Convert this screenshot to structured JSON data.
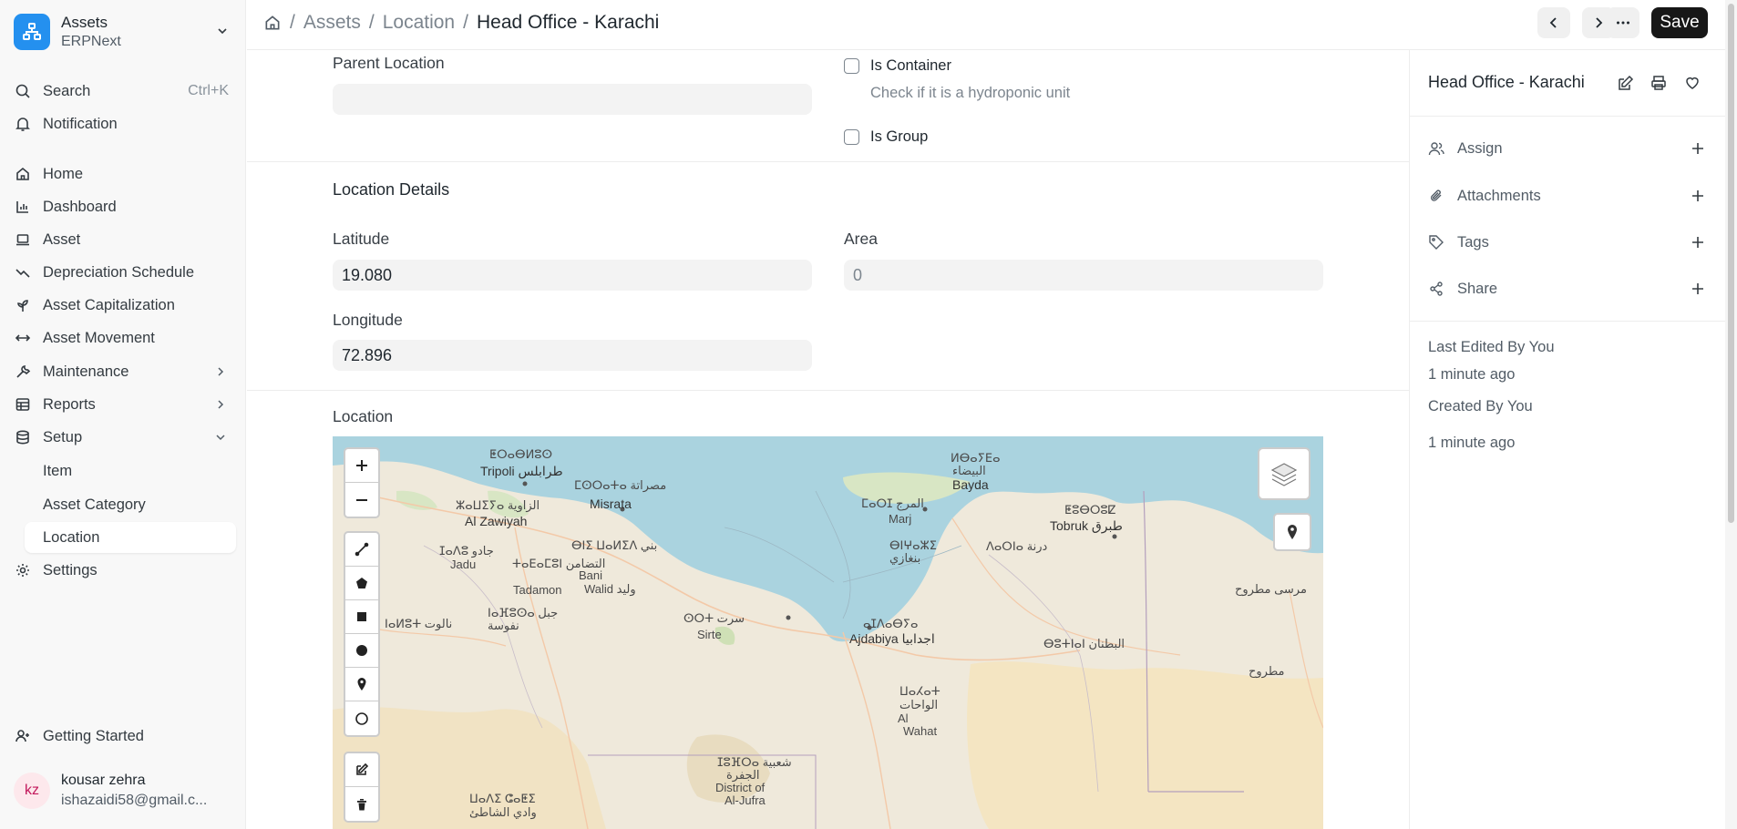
{
  "app": {
    "title": "Assets",
    "subtitle": "ERPNext"
  },
  "sidebar": {
    "search": {
      "label": "Search",
      "shortcut": "Ctrl+K"
    },
    "notification": "Notification",
    "items": [
      {
        "label": "Home"
      },
      {
        "label": "Dashboard"
      },
      {
        "label": "Asset"
      },
      {
        "label": "Depreciation Schedule"
      },
      {
        "label": "Asset Capitalization"
      },
      {
        "label": "Asset Movement"
      },
      {
        "label": "Maintenance"
      },
      {
        "label": "Reports"
      },
      {
        "label": "Setup"
      }
    ],
    "setup_children": [
      {
        "label": "Item"
      },
      {
        "label": "Asset Category"
      },
      {
        "label": "Location"
      }
    ],
    "settings": "Settings",
    "getting_started": "Getting Started",
    "user": {
      "initials": "kz",
      "name": "kousar zehra",
      "email": "ishazaidi58@gmail.c..."
    }
  },
  "breadcrumb": {
    "items": [
      "Assets",
      "Location"
    ],
    "current": "Head Office - Karachi"
  },
  "toolbar": {
    "save_label": "Save"
  },
  "form": {
    "parent_location": {
      "label": "Parent Location",
      "value": ""
    },
    "is_container": {
      "label": "Is Container",
      "help": "Check if it is a hydroponic unit"
    },
    "is_group": {
      "label": "Is Group"
    },
    "section_title": "Location Details",
    "latitude": {
      "label": "Latitude",
      "value": "19.080"
    },
    "area": {
      "label": "Area",
      "value": "0"
    },
    "longitude": {
      "label": "Longitude",
      "value": "72.896"
    },
    "location": {
      "label": "Location"
    }
  },
  "map": {
    "labels": {
      "tripoli_tf": "ⵟⵔⴰⴱⵍⵓⵙ",
      "tripoli": "Tripoli طرابلس",
      "misrata_tf": "ⵎⵙⵔⴰⵜⴰ مصراتة",
      "misrata": "Misrata",
      "zawiyah_tf": "ⵣⴰⵡⵉⵢⴰ الزاوية",
      "zawiyah": "Al Zawiyah",
      "jadu": "ⵊⴰⴷⵓ جادو",
      "jadu_en": "Jadu",
      "bani_walid": "ⴱⵏⵉ ⵡⴰⵍⵉⴷ بني",
      "bani_walid_en": "Bani",
      "walid": "Walid وليد",
      "tadamon": "ⵜⴰⴹⴰⵎⵓⵏ التضامن",
      "tadamon_en": "Tadamon",
      "nalut": "ⵏⴰⵍⵓⵜ نالوت",
      "nafusa": "ⵏⴰⴼⵓⵙⴰ جبل",
      "nafusa2": "نفوسة",
      "sirte": "ⵙⵔⵜ سرت",
      "sirte_en": "Sirte",
      "bayda_tf": "ⵍⴱⴰⵢⴹⴰ",
      "bayda_ar": "البيضاء",
      "bayda": "Bayda",
      "marj": "ⵎⴰⵔⵊ المرج",
      "marj_en": "Marj",
      "tobruk_tf": "ⵟⵓⴱⵔⵓⵇ",
      "tobruk": "Tobruk طبرق",
      "derna": "ⴷⴰⵔⵏⴰ درنة",
      "benghazi": "ⴱⵏⵖⴰⵣⵉ",
      "benghazi_ar": "بنغازي",
      "ajdabiya_tf": "ⴰⵊⴷⴰⴱⵢⴰ",
      "ajdabiya": "Ajdabiya اجدابيا",
      "marsa": "مرسى مطروح",
      "butnan": "ⴱⵓⵜⵏⴰⵏ البطنان",
      "wahat_tf": "ⵡⴰⵃⴰⵜ",
      "wahat_ar": "الواحات",
      "wahat_al": "Al",
      "wahat": "Wahat",
      "jufra_tf": "ⵊⵓⴼⵔⴰ شعبية",
      "jufra_ar": "الجفرة",
      "jufra1": "District of",
      "jufra2": "Al-Jufra",
      "shati_tf": "ⵡⴰⴷⵉ ⵛⴰⵟⵉ",
      "shati_ar": "وادي الشاطئ",
      "matruh_ar": "مطروح"
    }
  },
  "right_panel": {
    "title": "Head Office - Karachi",
    "actions": [
      {
        "label": "Assign"
      },
      {
        "label": "Attachments"
      },
      {
        "label": "Tags"
      },
      {
        "label": "Share"
      }
    ],
    "last_edited": "Last Edited By You",
    "last_edited_time": "1 minute ago",
    "created": "Created By You",
    "created_time": "1 minute ago"
  },
  "colors": {
    "accent": "#2490ef",
    "save_bg": "#171717",
    "sea": "#aad3df",
    "land": "#efe9db"
  }
}
